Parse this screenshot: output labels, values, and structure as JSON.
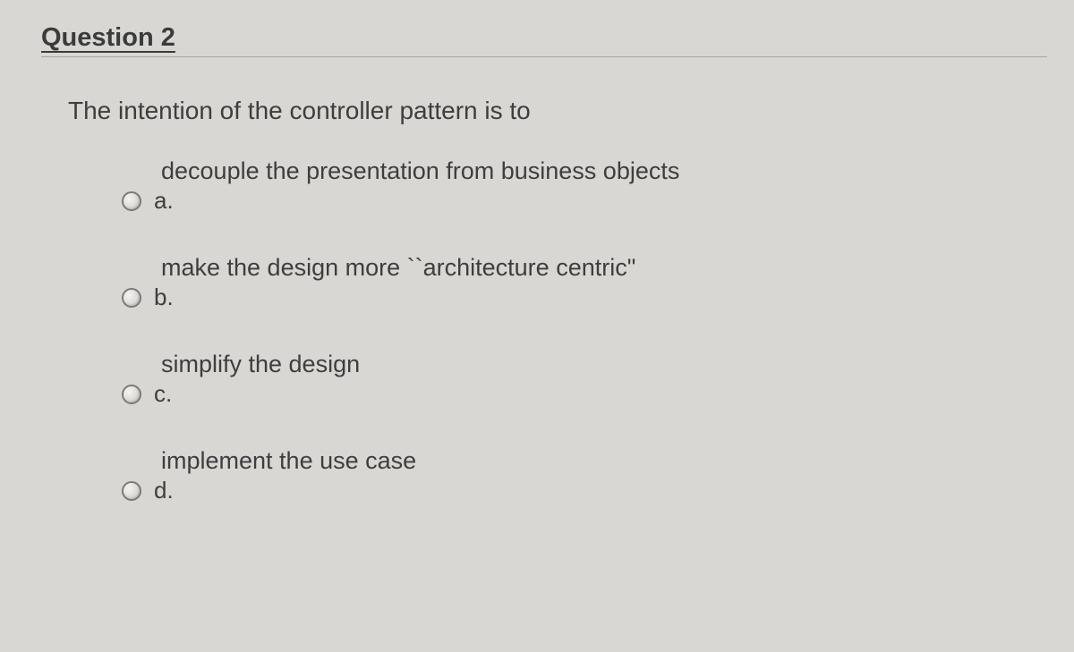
{
  "question": {
    "heading": "Question 2",
    "stem": "The intention of the controller pattern is to",
    "options": [
      {
        "letter": "a.",
        "text": "decouple the presentation from business objects"
      },
      {
        "letter": "b.",
        "text": "make the design more ``architecture centric\""
      },
      {
        "letter": "c.",
        "text": "simplify the design"
      },
      {
        "letter": "d.",
        "text": "implement the use case"
      }
    ]
  }
}
